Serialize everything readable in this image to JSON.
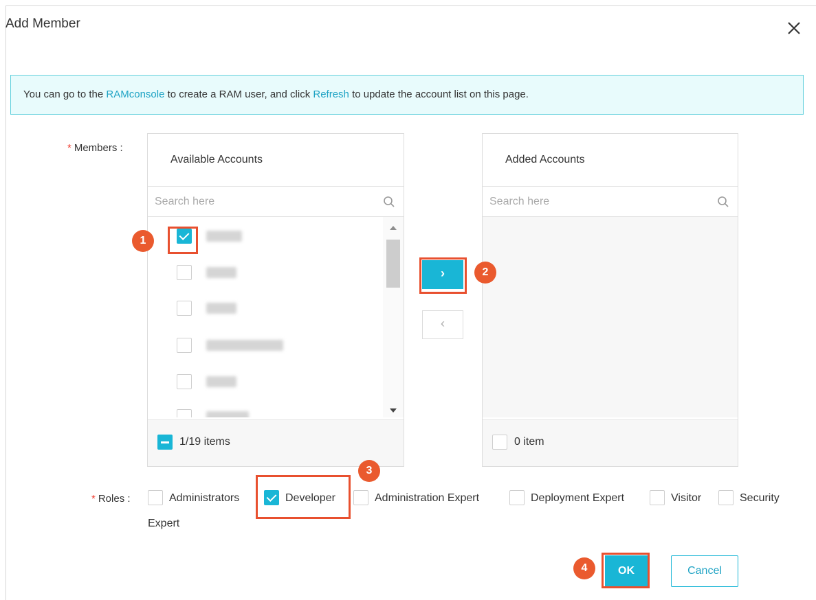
{
  "dialog": {
    "title": "Add Member"
  },
  "notice": {
    "prefix": "You can go to the ",
    "link1": "RAMconsole",
    "middle": " to create a RAM user, and click ",
    "link2": "Refresh",
    "suffix": " to update the account list on this page."
  },
  "members_label": "Members :",
  "roles_label": "Roles :",
  "available": {
    "header": "Available Accounts",
    "search_placeholder": "Search here",
    "footer": "1/19 items"
  },
  "added": {
    "header": "Added Accounts",
    "search_placeholder": "Search here",
    "footer": "0 item"
  },
  "transfer": {
    "right": "›",
    "left": "‹"
  },
  "roles": [
    {
      "label": "Administrators",
      "checked": false
    },
    {
      "label": "Developer",
      "checked": true
    },
    {
      "label": "Administration Expert",
      "checked": false
    },
    {
      "label": "Deployment Expert",
      "checked": false
    },
    {
      "label": "Visitor",
      "checked": false
    },
    {
      "label": "Security",
      "checked": false
    }
  ],
  "roles_wrap": "Expert",
  "buttons": {
    "ok": "OK",
    "cancel": "Cancel"
  },
  "steps": [
    "1",
    "2",
    "3",
    "4"
  ],
  "colors": {
    "accent": "#19b6d6",
    "highlight": "#e8502f",
    "badge": "#ea5a2e",
    "required": "#f04134"
  }
}
